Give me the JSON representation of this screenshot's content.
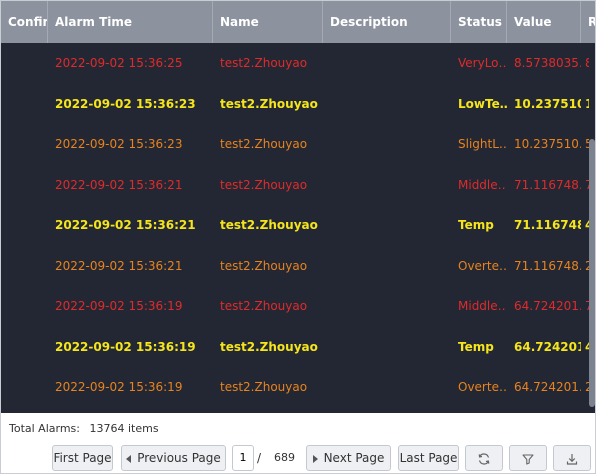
{
  "table": {
    "columns": [
      "Confirm",
      "Alarm Time",
      "Name",
      "Description",
      "Status",
      "Value",
      "R"
    ],
    "rows": [
      {
        "color": "#e02b2b",
        "bold": false,
        "time": "2022-09-02 15:36:25",
        "name": "test2.Zhouyao",
        "desc": "",
        "status": "VeryLo…",
        "value": "8.5738035…",
        "extra": "8"
      },
      {
        "color": "#f5e51a",
        "bold": true,
        "time": "2022-09-02 15:36:23",
        "name": "test2.Zhouyao",
        "desc": "",
        "status": "LowTe…",
        "value": "10.237510…",
        "extra": "1"
      },
      {
        "color": "#e8831e",
        "bold": false,
        "time": "2022-09-02 15:36:23",
        "name": "test2.Zhouyao",
        "desc": "",
        "status": "SlightL…",
        "value": "10.237510…",
        "extra": "5"
      },
      {
        "color": "#e02b2b",
        "bold": false,
        "time": "2022-09-02 15:36:21",
        "name": "test2.Zhouyao",
        "desc": "",
        "status": "Middle…",
        "value": "71.116748…",
        "extra": "7"
      },
      {
        "color": "#f5e51a",
        "bold": true,
        "time": "2022-09-02 15:36:21",
        "name": "test2.Zhouyao",
        "desc": "",
        "status": "Temp",
        "value": "71.116748…",
        "extra": "4"
      },
      {
        "color": "#e8831e",
        "bold": false,
        "time": "2022-09-02 15:36:21",
        "name": "test2.Zhouyao",
        "desc": "",
        "status": "Overte…",
        "value": "71.116748…",
        "extra": "2"
      },
      {
        "color": "#e02b2b",
        "bold": false,
        "time": "2022-09-02 15:36:19",
        "name": "test2.Zhouyao",
        "desc": "",
        "status": "Middle…",
        "value": "64.724201…",
        "extra": "7"
      },
      {
        "color": "#f5e51a",
        "bold": true,
        "time": "2022-09-02 15:36:19",
        "name": "test2.Zhouyao",
        "desc": "",
        "status": "Temp",
        "value": "64.724201…",
        "extra": "4"
      },
      {
        "color": "#e8831e",
        "bold": false,
        "time": "2022-09-02 15:36:19",
        "name": "test2.Zhouyao",
        "desc": "",
        "status": "Overte…",
        "value": "64.724201…",
        "extra": "2"
      }
    ]
  },
  "footer": {
    "total_label": "Total Alarms:",
    "total_value": "13764 items",
    "first_page": "First Page",
    "previous_page": "Previous Page",
    "current_page": "1",
    "separator": "/",
    "total_pages": "689",
    "next_page": "Next Page",
    "last_page": "Last Page",
    "refresh_icon": "refresh-icon",
    "filter_icon": "filter-icon",
    "download_icon": "download-icon"
  },
  "colors": {
    "header_bg": "#8c929e",
    "table_bg": "#222733",
    "red": "#e02b2b",
    "yellow": "#f5e51a",
    "orange": "#e8831e"
  }
}
